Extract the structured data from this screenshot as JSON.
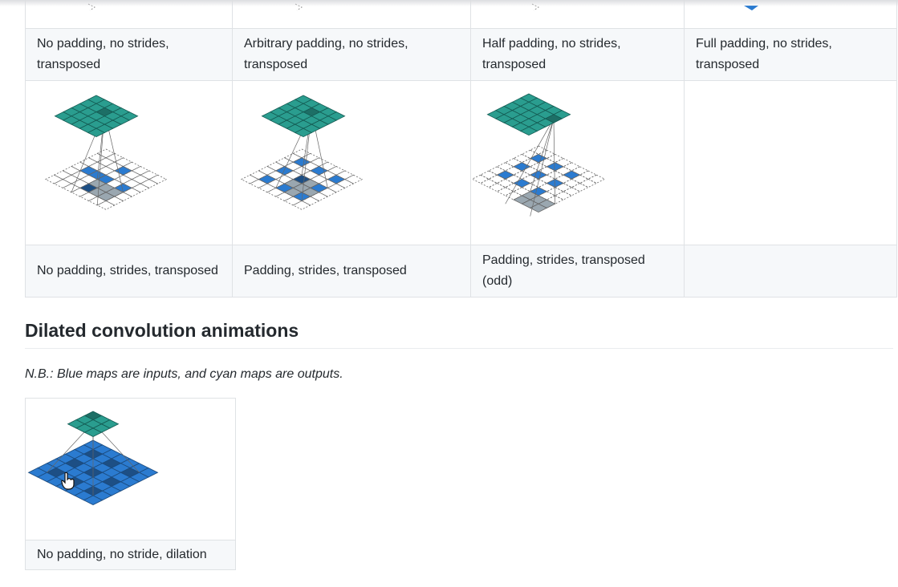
{
  "table": {
    "captions_row1": [
      "No padding, no strides, transposed",
      "Arbitrary padding, no strides, transposed",
      "Half padding, no strides, transposed",
      "Full padding, no strides, transposed"
    ],
    "captions_row2": [
      "No padding, strides, transposed",
      "Padding, strides, transposed",
      "Padding, strides, transposed (odd)",
      ""
    ]
  },
  "section": {
    "title": "Dilated convolution animations",
    "note": "N.B.: Blue maps are inputs, and cyan maps are outputs."
  },
  "dilation": {
    "caption": "No padding, no stride, dilation"
  },
  "colors": {
    "output": "#2a9d8f",
    "output_dark": "#1d6f66",
    "input": "#2b7bd0",
    "input_dark": "#1d4f85",
    "kernel": "#9aa7b0",
    "border": "#dfe2e5",
    "caption_bg": "#f6f8fa"
  },
  "icons": {
    "cursor": "hand-pointer-icon"
  }
}
